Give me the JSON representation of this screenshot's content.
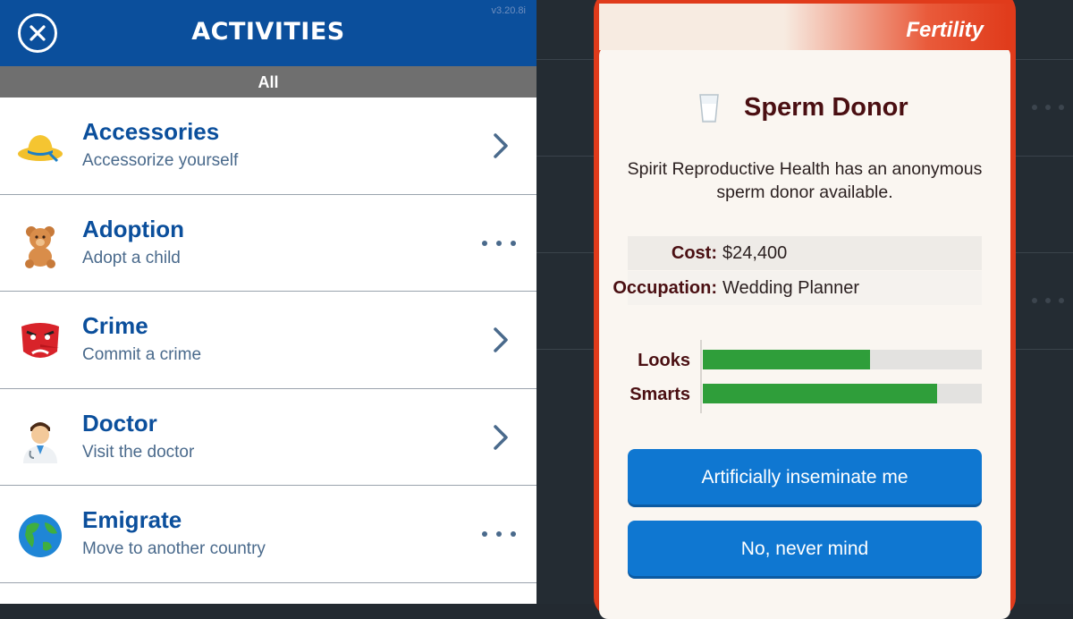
{
  "header": {
    "title": "ACTIVITIES",
    "version": "v3.20.8i",
    "close_icon": "close-icon",
    "color": "#0b4f9c"
  },
  "filter": {
    "label": "All"
  },
  "activities": [
    {
      "name": "Accessories",
      "subtitle": "Accessorize yourself",
      "icon": "sun-hat-icon",
      "action": "chevron"
    },
    {
      "name": "Adoption",
      "subtitle": "Adopt a child",
      "icon": "teddy-bear-icon",
      "action": "more"
    },
    {
      "name": "Crime",
      "subtitle": "Commit a crime",
      "icon": "tengu-mask-icon",
      "action": "chevron"
    },
    {
      "name": "Doctor",
      "subtitle": "Visit the doctor",
      "icon": "doctor-icon",
      "action": "chevron"
    },
    {
      "name": "Emigrate",
      "subtitle": "Move to another country",
      "icon": "globe-icon",
      "action": "more"
    }
  ],
  "popup": {
    "category": "Fertility",
    "title": "Sperm Donor",
    "icon": "milk-glass-icon",
    "description": "Spirit Reproductive Health has an anonymous sperm donor available.",
    "details": [
      {
        "key": "Cost:",
        "value": "$24,400"
      },
      {
        "key": "Occupation:",
        "value": "Wedding Planner"
      }
    ],
    "stats": [
      {
        "label": "Looks",
        "value": 0.6
      },
      {
        "label": "Smarts",
        "value": 0.84
      }
    ],
    "buttons": {
      "confirm": "Artificially inseminate me",
      "cancel": "No, never mind"
    },
    "colors": {
      "frame": "#e03b1b",
      "bar": "#2f9e3a",
      "button": "#0f77d1"
    }
  }
}
